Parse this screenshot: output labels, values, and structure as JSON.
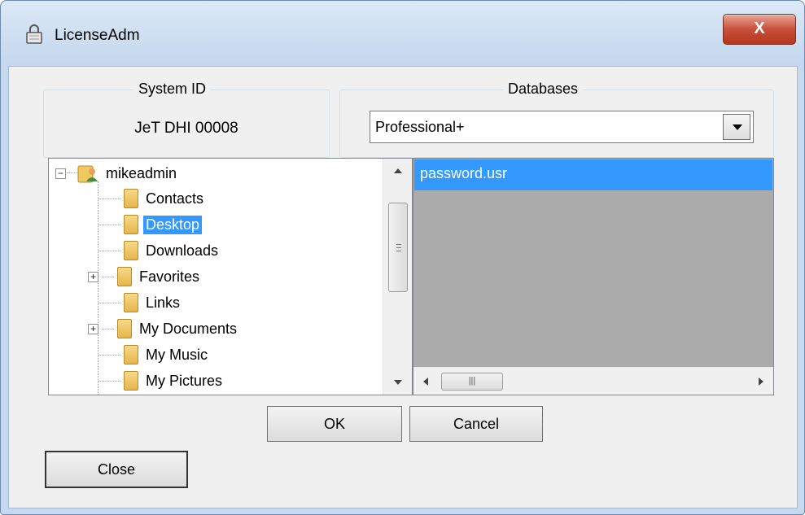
{
  "window": {
    "title": "LicenseAdm",
    "close_glyph": "X",
    "title_icon": "lock-icon"
  },
  "system_id": {
    "label": "System ID",
    "value": "JeT DHI 00008"
  },
  "databases": {
    "label": "Databases",
    "selected": "Professional+"
  },
  "tree": {
    "root": "mikeadmin",
    "items": [
      {
        "label": "Contacts",
        "icon": "contacts-folder-icon",
        "expandable": false,
        "selected": false
      },
      {
        "label": "Desktop",
        "icon": "desktop-folder-icon",
        "expandable": false,
        "selected": true
      },
      {
        "label": "Downloads",
        "icon": "downloads-folder-icon",
        "expandable": false,
        "selected": false
      },
      {
        "label": "Favorites",
        "icon": "favorites-folder-icon",
        "expandable": true,
        "selected": false
      },
      {
        "label": "Links",
        "icon": "links-folder-icon",
        "expandable": false,
        "selected": false
      },
      {
        "label": "My Documents",
        "icon": "documents-folder-icon",
        "expandable": true,
        "selected": false
      },
      {
        "label": "My Music",
        "icon": "music-folder-icon",
        "expandable": false,
        "selected": false
      },
      {
        "label": "My Pictures",
        "icon": "pictures-folder-icon",
        "expandable": false,
        "selected": false
      }
    ]
  },
  "files": {
    "items": [
      "password.usr"
    ]
  },
  "buttons": {
    "ok": "OK",
    "cancel": "Cancel",
    "close": "Close"
  },
  "colors": {
    "selection": "#3399ff",
    "file_list_bg": "#ababab",
    "title_bar": "#c4d7ee"
  }
}
